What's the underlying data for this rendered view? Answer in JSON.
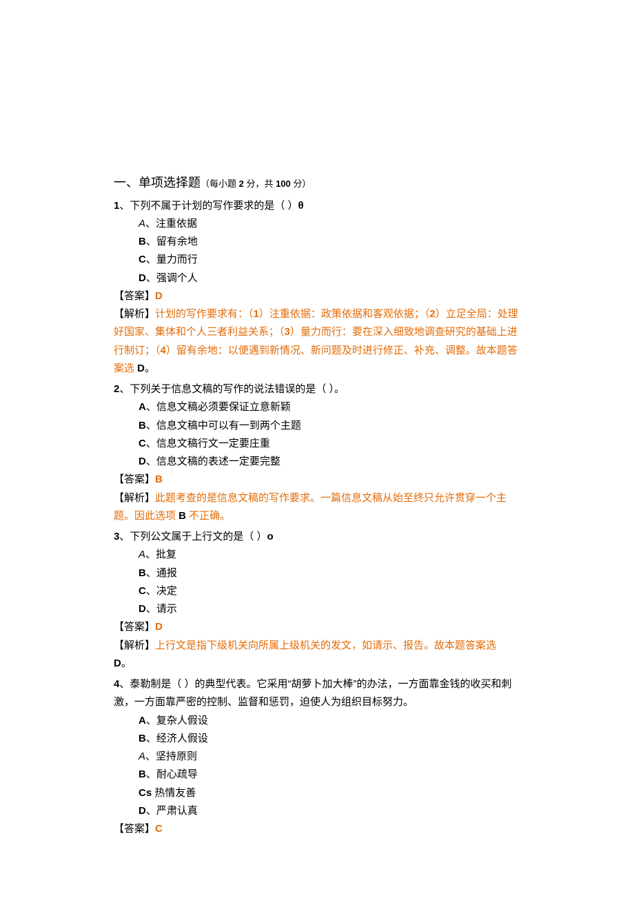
{
  "section": {
    "title_main": "一、单项选择题",
    "title_sub_prefix": "（每小题 ",
    "title_sub_points": "2",
    "title_sub_mid": " 分，共 ",
    "title_sub_total": "100",
    "title_sub_suffix": " 分）"
  },
  "q1": {
    "num": "1",
    "stem": "、下列不属于计划的写作要求的是（ ）",
    "stem_tail": "θ",
    "a_letter": "A",
    "a_text": "、注重依据",
    "b_letter": "B",
    "b_text": "、留有余地",
    "c_letter": "C",
    "c_text": "、量力而行",
    "d_letter": "D",
    "d_text": "、强调个人",
    "ans_label": "【答案】",
    "ans_val": "D",
    "exp_label": "【解析】",
    "exp_part1": "计划的写作要求有：（",
    "exp_b1": "1",
    "exp_part2": "）注重依据：政策依据和客观依据；（",
    "exp_b2": "2",
    "exp_part3": "）立足全局：处理好国家、集体和个人三者利益关系；（",
    "exp_b3": "3",
    "exp_part4": "）量力而行：要在深入细致地调查研究的基础上进行制订；（",
    "exp_b4": "4",
    "exp_part5": "）留有余地：以便遇到新情况、新问题及时进行修正、补充、调整。故本题答案选 ",
    "exp_tail": "D",
    "exp_period": "。"
  },
  "q2": {
    "num": "2",
    "stem": "、下列关于信息文稿的写作的说法错误的是（ ）。",
    "a_letter": "A",
    "a_text": "、信息文稿必须要保证立意新颖",
    "b_letter": "B",
    "b_text": "、信息文稿中可以有一到两个主题",
    "c_letter": "C",
    "c_text": "、信息文稿行文一定要庄重",
    "d_letter": "D",
    "d_text": "、信息文稿的表述一定要完整",
    "ans_label": "【答案】",
    "ans_val": "B",
    "exp_label": "【解析】",
    "exp_part1": "此题考查的是信息文稿的写作要求。一篇信息文稿从始至终只允许贯穿一个主题。因此选项 ",
    "exp_b1": "B",
    "exp_part2": " 不正确。"
  },
  "q3": {
    "num": "3",
    "stem": "、下列公文属于上行文的是（ ）",
    "stem_tail": "o",
    "a_letter": "A",
    "a_text": "、批复",
    "b_letter": "B",
    "b_text": "、通报",
    "c_letter": "C",
    "c_text": "、决定",
    "d_letter": "D",
    "d_text": "、请示",
    "ans_label": "【答案】",
    "ans_val": "D",
    "exp_label": "【解析】",
    "exp_part1": "上行文是指下级机关向所属上级机关的发文，如请示、报告。故本题答案选",
    "exp_tail_line": "D",
    "exp_tail_suffix": "。"
  },
  "q4": {
    "num": "4",
    "stem": "、泰勒制是（ ）的典型代表。它采用“胡萝卜加大棒”的办法，一方面靠金钱的收买和刺激，一方面靠严密的控制、监督和惩罚，迫使人为组织目标努力。",
    "a_letter": "A",
    "a_text": "、复杂人假设",
    "b_letter": "B",
    "b_text": "、经济人假设",
    "a2_letter": "A",
    "a2_text": "、坚持原则",
    "b2_letter": "B",
    "b2_text": "、耐心疏导",
    "cs_letter": "Cs",
    "cs_text": " 热情友善",
    "d_letter": "D",
    "d_text": "、严肃认真",
    "ans_label": "【答案】",
    "ans_val": "C"
  }
}
